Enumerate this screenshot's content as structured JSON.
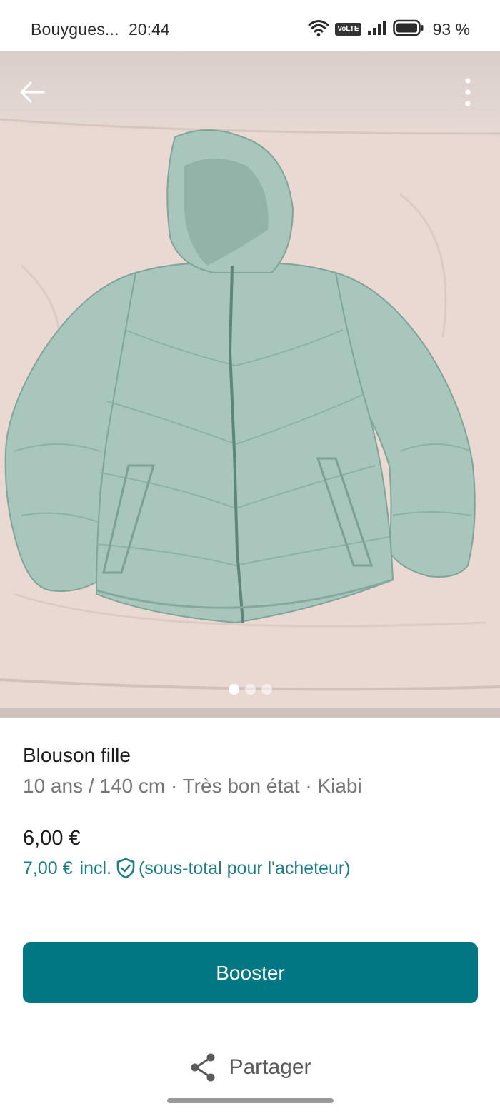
{
  "status_bar": {
    "carrier": "Bouygues...",
    "time": "20:44",
    "volte": "VoLTE",
    "battery": "93 %",
    "icons": [
      "wifi-icon",
      "volte-icon",
      "signal-icon",
      "battery-icon"
    ]
  },
  "gallery": {
    "image_count": 3,
    "active_index": 0,
    "icons": [
      "back-arrow-icon",
      "more-vertical-icon"
    ]
  },
  "item": {
    "title": "Blouson fille",
    "details": "10 ans / 140 cm · Très bon état · Kiabi",
    "price": "6,00 €",
    "buyer_price": "7,00 €",
    "incl_label": "incl.",
    "buyer_note": "(sous-total pour l'acheteur)"
  },
  "actions": {
    "boost_label": "Booster",
    "share_label": "Partager"
  },
  "colors": {
    "primary": "#007782",
    "link": "#1f7b86",
    "secondary_text": "#757575"
  }
}
